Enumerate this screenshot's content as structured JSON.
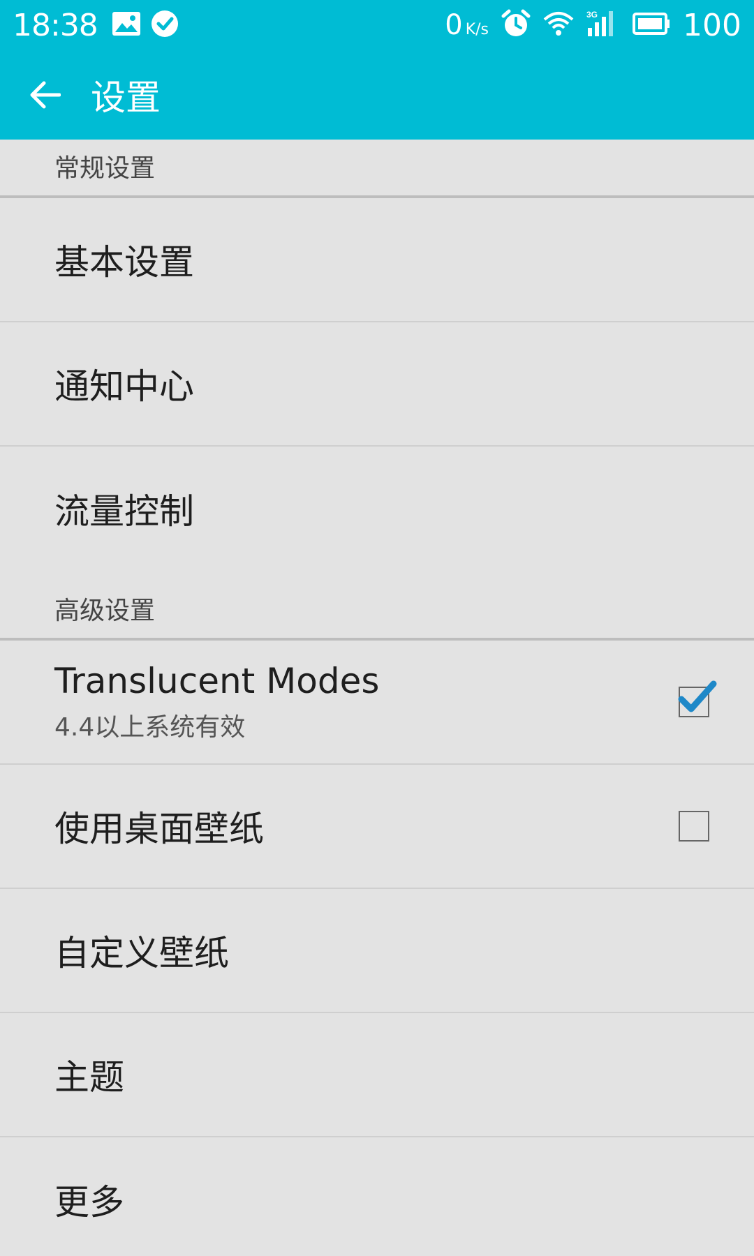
{
  "status_bar": {
    "time": "18:38",
    "net_speed_value": "0",
    "net_speed_unit": "K/s",
    "battery": "100",
    "left_icons": [
      "image-icon",
      "check-circle-icon"
    ],
    "right_icons": [
      "alarm-icon",
      "wifi-icon",
      "signal-3g-icon",
      "battery-icon"
    ]
  },
  "toolbar": {
    "title": "设置"
  },
  "sections": {
    "general": {
      "header": "常规设置",
      "items": [
        "基本设置",
        "通知中心",
        "流量控制"
      ]
    },
    "advanced": {
      "header": "高级设置",
      "translucent": {
        "title": "Translucent Modes",
        "summary": "4.4以上系统有效",
        "checked": true
      },
      "desktop_wallpaper": {
        "title": "使用桌面壁纸",
        "checked": false
      },
      "items": [
        "自定义壁纸",
        "主题",
        "更多"
      ]
    }
  },
  "colors": {
    "accent": "#00bcd4",
    "check": "#1e88c8",
    "background": "#e3e3e3"
  }
}
